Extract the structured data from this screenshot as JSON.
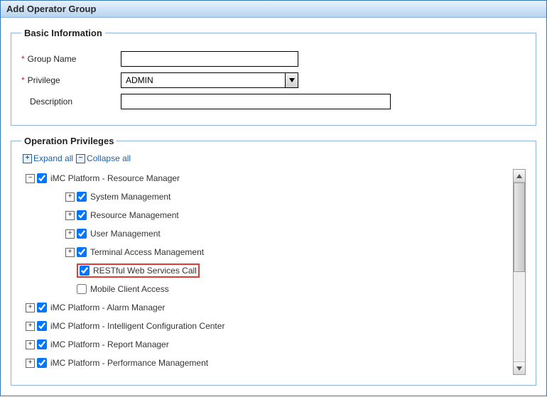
{
  "header": {
    "title": "Add Operator Group"
  },
  "basic": {
    "legend": "Basic Information",
    "groupName": {
      "label": "Group Name",
      "value": ""
    },
    "privilege": {
      "label": "Privilege",
      "value": "ADMIN"
    },
    "description": {
      "label": "Description",
      "value": ""
    }
  },
  "ops": {
    "legend": "Operation Privileges",
    "expandAll": "Expand all",
    "collapseAll": "Collapse all",
    "tree": [
      {
        "label": "iMC Platform - Resource Manager",
        "checked": true,
        "expand": "-",
        "children": [
          {
            "label": "System Management",
            "checked": true,
            "expand": "+"
          },
          {
            "label": "Resource Management",
            "checked": true,
            "expand": "+"
          },
          {
            "label": "User Management",
            "checked": true,
            "expand": "+"
          },
          {
            "label": "Terminal Access Management",
            "checked": true,
            "expand": "+"
          },
          {
            "label": "RESTful Web Services Call",
            "checked": true,
            "expand": null,
            "highlight": true
          },
          {
            "label": "Mobile Client Access",
            "checked": false,
            "expand": null
          }
        ]
      },
      {
        "label": "iMC Platform - Alarm Manager",
        "checked": true,
        "expand": "+"
      },
      {
        "label": "iMC Platform - Intelligent Configuration Center",
        "checked": true,
        "expand": "+"
      },
      {
        "label": "iMC Platform - Report Manager",
        "checked": true,
        "expand": "+"
      },
      {
        "label": "iMC Platform - Performance Management",
        "checked": true,
        "expand": "+"
      }
    ]
  }
}
